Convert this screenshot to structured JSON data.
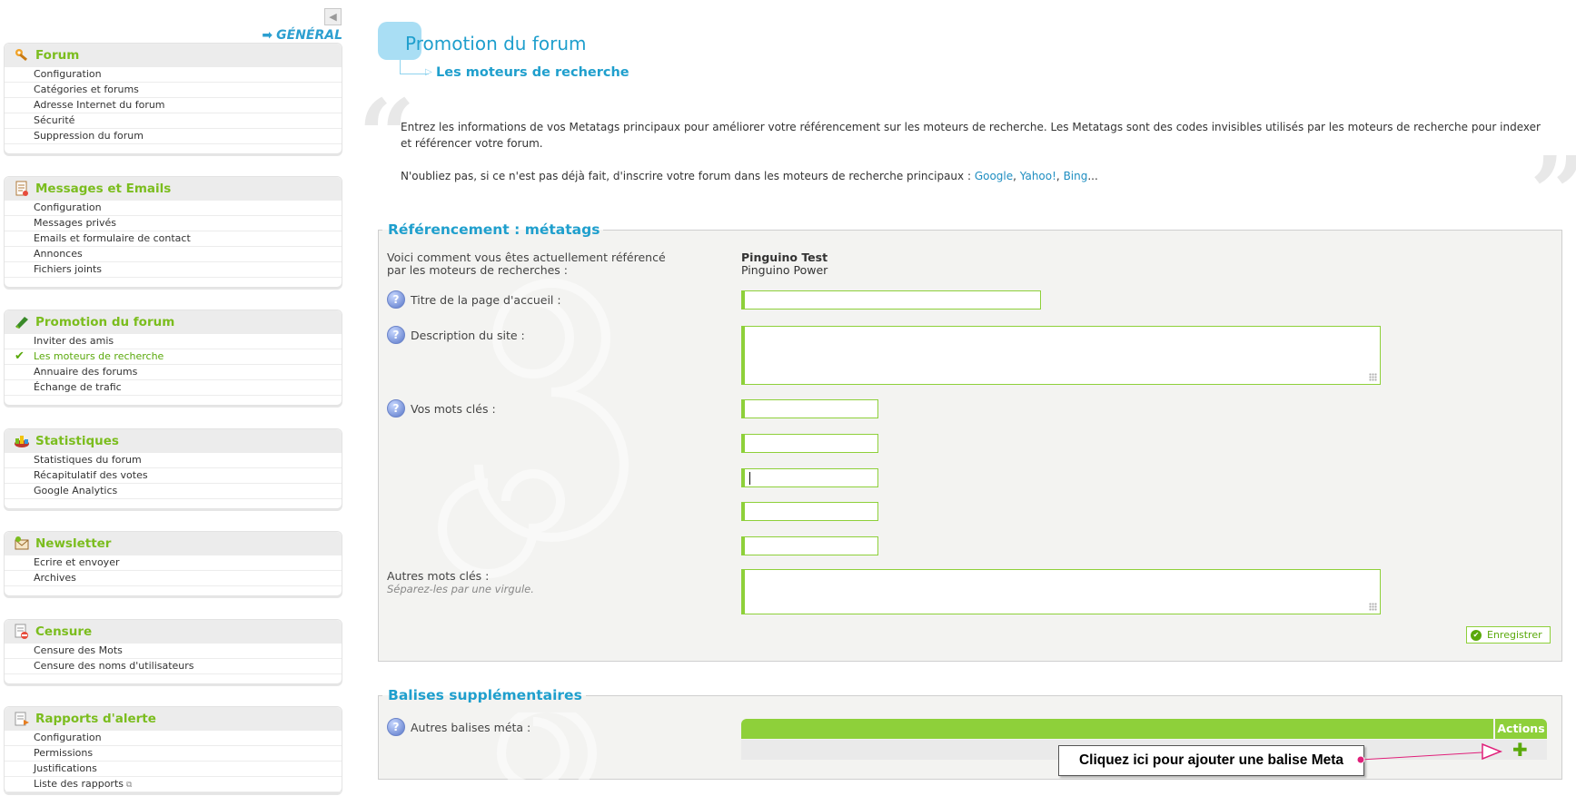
{
  "sidebar": {
    "collapse_glyph": "◀",
    "general_title": "GÉNÉRAL",
    "sections": [
      {
        "title": "Forum",
        "icon": "wrench-icon",
        "items": [
          "Configuration",
          "Catégories et forums",
          "Adresse Internet du forum",
          "Sécurité",
          "Suppression du forum"
        ]
      },
      {
        "title": "Messages et Emails",
        "icon": "document-icon",
        "items": [
          "Configuration",
          "Messages privés",
          "Emails et formulaire de contact",
          "Annonces",
          "Fichiers joints"
        ]
      },
      {
        "title": "Promotion du forum",
        "icon": "promotion-icon",
        "items": [
          "Inviter des amis",
          "Les moteurs de recherche",
          "Annuaire des forums",
          "Échange de trafic"
        ],
        "active_index": 1
      },
      {
        "title": "Statistiques",
        "icon": "chart-icon",
        "items": [
          "Statistiques du forum",
          "Récapitulatif des votes",
          "Google Analytics"
        ]
      },
      {
        "title": "Newsletter",
        "icon": "newsletter-icon",
        "items": [
          "Ecrire et envoyer",
          "Archives"
        ]
      },
      {
        "title": "Censure",
        "icon": "censor-icon",
        "items": [
          "Censure des Mots",
          "Censure des noms d'utilisateurs"
        ]
      },
      {
        "title": "Rapports d'alerte",
        "icon": "alert-report-icon",
        "items": [
          "Configuration",
          "Permissions",
          "Justifications",
          "Liste des rapports"
        ]
      }
    ]
  },
  "main": {
    "title": "Promotion du forum",
    "subtitle": "Les moteurs de recherche",
    "intro_1": "Entrez les informations de vos Metatags principaux pour améliorer votre référencement sur les moteurs de recherche. Les Metatags sont des codes invisibles utilisés par les moteurs de recherche pour indexer et référencer votre forum.",
    "intro_2_prefix": "N'oubliez pas, si ce n'est pas déjà fait, d'inscrire votre forum dans les moteurs de recherche principaux : ",
    "links": [
      "Google",
      "Yahoo!",
      "Bing"
    ],
    "link_sep": ", ",
    "ellipsis": "...",
    "meta_box": {
      "legend": "Référencement : métatags",
      "current_label_1": "Voici comment vous êtes actuellement référencé",
      "current_label_2": "par les moteurs de recherches :",
      "current_title": "Pinguino Test",
      "current_desc": "Pinguino Power",
      "homepage_title_label": "Titre de la page d'accueil :",
      "homepage_title_value": "",
      "description_label": "Description du site :",
      "description_value": "",
      "keywords_label": "Vos mots clés :",
      "keywords": [
        "",
        "",
        "",
        "",
        ""
      ],
      "other_keywords_label": "Autres mots clés :",
      "other_keywords_hint": "Séparez-les par une virgule.",
      "other_keywords_value": "",
      "save_label": "Enregistrer"
    },
    "extra_box": {
      "legend": "Balises supplémentaires",
      "other_tags_label": "Autres balises méta :",
      "actions_header": "Actions",
      "add_glyph": "✚"
    },
    "tooltip": "Cliquez ici pour ajouter une balise Meta",
    "colors": {
      "accent_blue": "#1f9fcd",
      "accent_green": "#8ed03a",
      "tooltip_arrow": "#e0207a"
    }
  }
}
